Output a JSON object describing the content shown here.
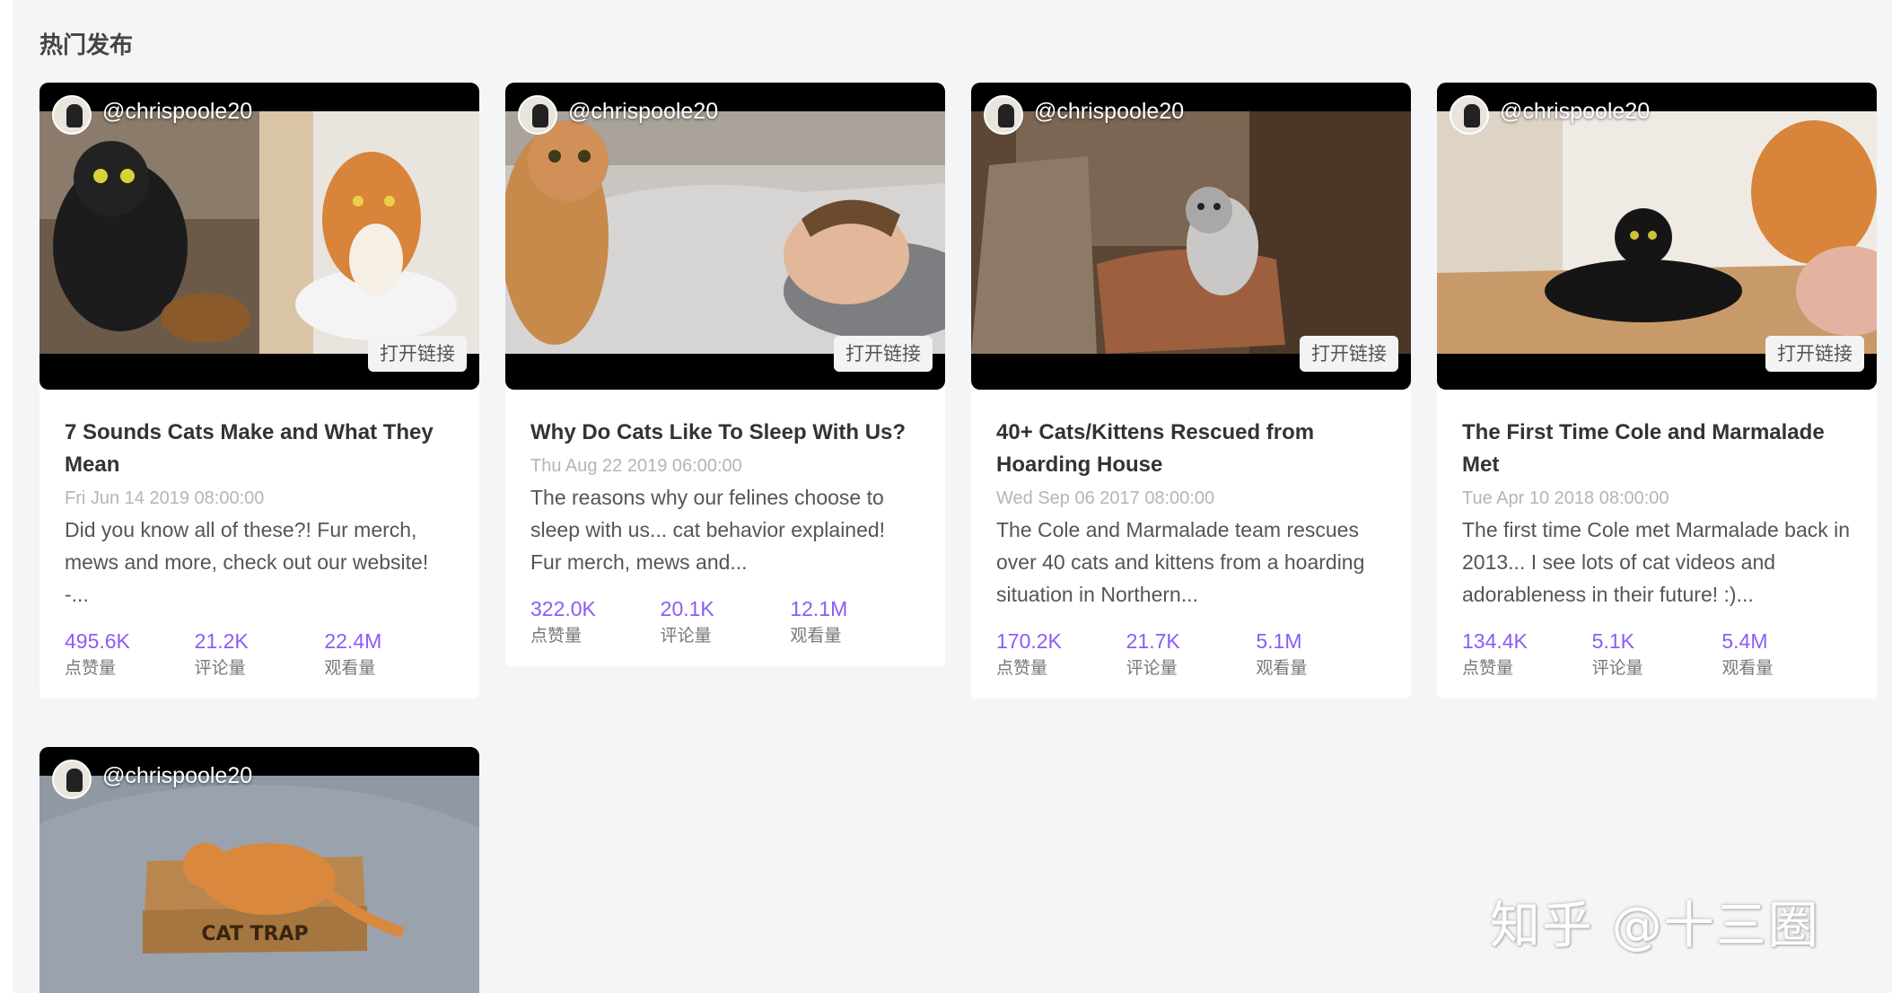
{
  "section": {
    "title": "热门发布"
  },
  "cards": [
    {
      "handle": "@chrispoole20",
      "open_label": "打开链接",
      "title": "7 Sounds Cats Make and What They Mean",
      "date": "Fri Jun 14 2019 08:00:00",
      "desc": "Did you know all of these?! Fur merch, mews and more, check out our website! -...",
      "likes": "495.6K",
      "likes_label": "点赞量",
      "comments": "21.2K",
      "comments_label": "评论量",
      "views": "22.4M",
      "views_label": "观看量"
    },
    {
      "handle": "@chrispoole20",
      "open_label": "打开链接",
      "title": "Why Do Cats Like To Sleep With Us?",
      "date": "Thu Aug 22 2019 06:00:00",
      "desc": "The reasons why our felines choose to sleep with us... cat behavior explained! Fur merch, mews and...",
      "likes": "322.0K",
      "likes_label": "点赞量",
      "comments": "20.1K",
      "comments_label": "评论量",
      "views": "12.1M",
      "views_label": "观看量"
    },
    {
      "handle": "@chrispoole20",
      "open_label": "打开链接",
      "title": "40+ Cats/Kittens Rescued from Hoarding House",
      "date": "Wed Sep 06 2017 08:00:00",
      "desc": "The Cole and Marmalade team rescues over 40 cats and kittens from a hoarding situation in Northern...",
      "likes": "170.2K",
      "likes_label": "点赞量",
      "comments": "21.7K",
      "comments_label": "评论量",
      "views": "5.1M",
      "views_label": "观看量"
    },
    {
      "handle": "@chrispoole20",
      "open_label": "打开链接",
      "title": "The First Time Cole and Marmalade Met",
      "date": "Tue Apr 10 2018 08:00:00",
      "desc": "The first time Cole met Marmalade back in 2013... I see lots of cat videos and adorableness in their future! :)...",
      "likes": "134.4K",
      "likes_label": "点赞量",
      "comments": "5.1K",
      "comments_label": "评论量",
      "views": "5.4M",
      "views_label": "观看量"
    },
    {
      "handle": "@chrispoole20",
      "thumb_text": "CAT TRAP"
    }
  ],
  "watermark": "知乎 @十三圈"
}
